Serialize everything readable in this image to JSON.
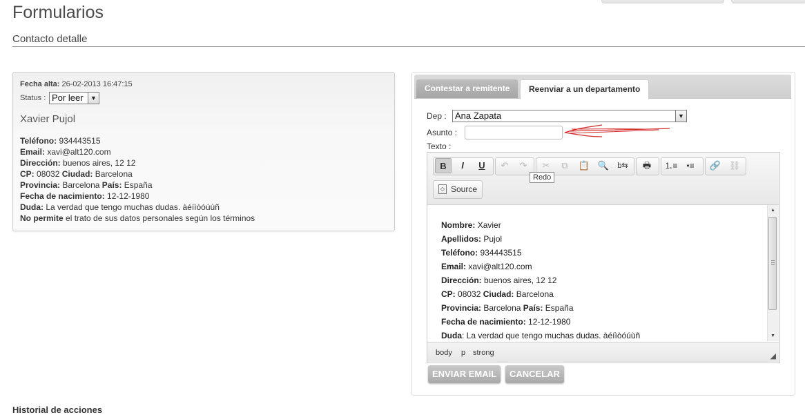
{
  "header": {
    "title": "Formularios",
    "subtitle": "Contacto detalle"
  },
  "contact": {
    "fecha_label": "Fecha alta:",
    "fecha_value": "26-02-2013 16:47:15",
    "status_label": "Status :",
    "status_value": "Por leer",
    "name": "Xavier Pujol",
    "telefono_label": "Teléfono:",
    "telefono": "934443515",
    "email_label": "Email:",
    "email": "xavi@alt120.com",
    "direccion_label": "Dirección:",
    "direccion": "buenos aires, 12 12",
    "cp_label": "CP:",
    "cp": "08032",
    "ciudad_label": "Ciudad:",
    "ciudad": "Barcelona",
    "provincia_label": "Provincia:",
    "provincia": "Barcelona",
    "pais_label": "País:",
    "pais": "España",
    "nacimiento_label": "Fecha de nacimiento:",
    "nacimiento": "12-12-1980",
    "duda_label": "Duda:",
    "duda": "La verdad que tengo muchas dudas. àéíìòóúùñ",
    "permite_label": "No permite",
    "permite": "el trato de sus datos personales según los términos"
  },
  "tabs": [
    {
      "label": "Contestar a remitente"
    },
    {
      "label": "Reenviar a un departamento"
    }
  ],
  "form": {
    "dep_label": "Dep :",
    "dep_value": "Ana Zapata",
    "asunto_label": "Asunto :",
    "asunto_value": "",
    "texto_label": "Texto :"
  },
  "editor": {
    "tooltip": "Redo",
    "source_label": "Source",
    "icons": [
      "bold-icon",
      "italic-icon",
      "underline-icon",
      "undo-icon",
      "redo-icon",
      "cut-icon",
      "copy-icon",
      "paste-icon",
      "find-icon",
      "replace-icon",
      "print-icon",
      "numbered-list-icon",
      "bulleted-list-icon",
      "link-icon",
      "unlink-icon"
    ],
    "lines": [
      {
        "label": "Nombre:",
        "value": "Xavier"
      },
      {
        "label": "Apellidos:",
        "value": "Pujol"
      },
      {
        "label": "Teléfono:",
        "value": "934443515"
      },
      {
        "label": "Email:",
        "value": "xavi@alt120.com"
      },
      {
        "label": "Dirección:",
        "value": "buenos aires, 12 12"
      },
      {
        "label": "CP:",
        "value": "08032",
        "label2": "Ciudad:",
        "value2": "Barcelona"
      },
      {
        "label": "Provincia:",
        "value": "Barcelona",
        "label2": "País:",
        "value2": "España"
      },
      {
        "label": "Fecha de nacimiento:",
        "value": "12-12-1980"
      },
      {
        "label": "Duda",
        "value": ": La verdad que tengo muchas dudas. àéíìòóúùñ"
      }
    ],
    "path": [
      "body",
      "p",
      "strong"
    ]
  },
  "actions": {
    "send": "ENVIAR EMAIL",
    "cancel": "CANCELAR"
  },
  "history": {
    "title": "Historial de acciones"
  },
  "colors": {
    "annotation": "#d42a2a",
    "tab_active_bg": "#ffffff",
    "button_bg": "#b5b5b5"
  }
}
